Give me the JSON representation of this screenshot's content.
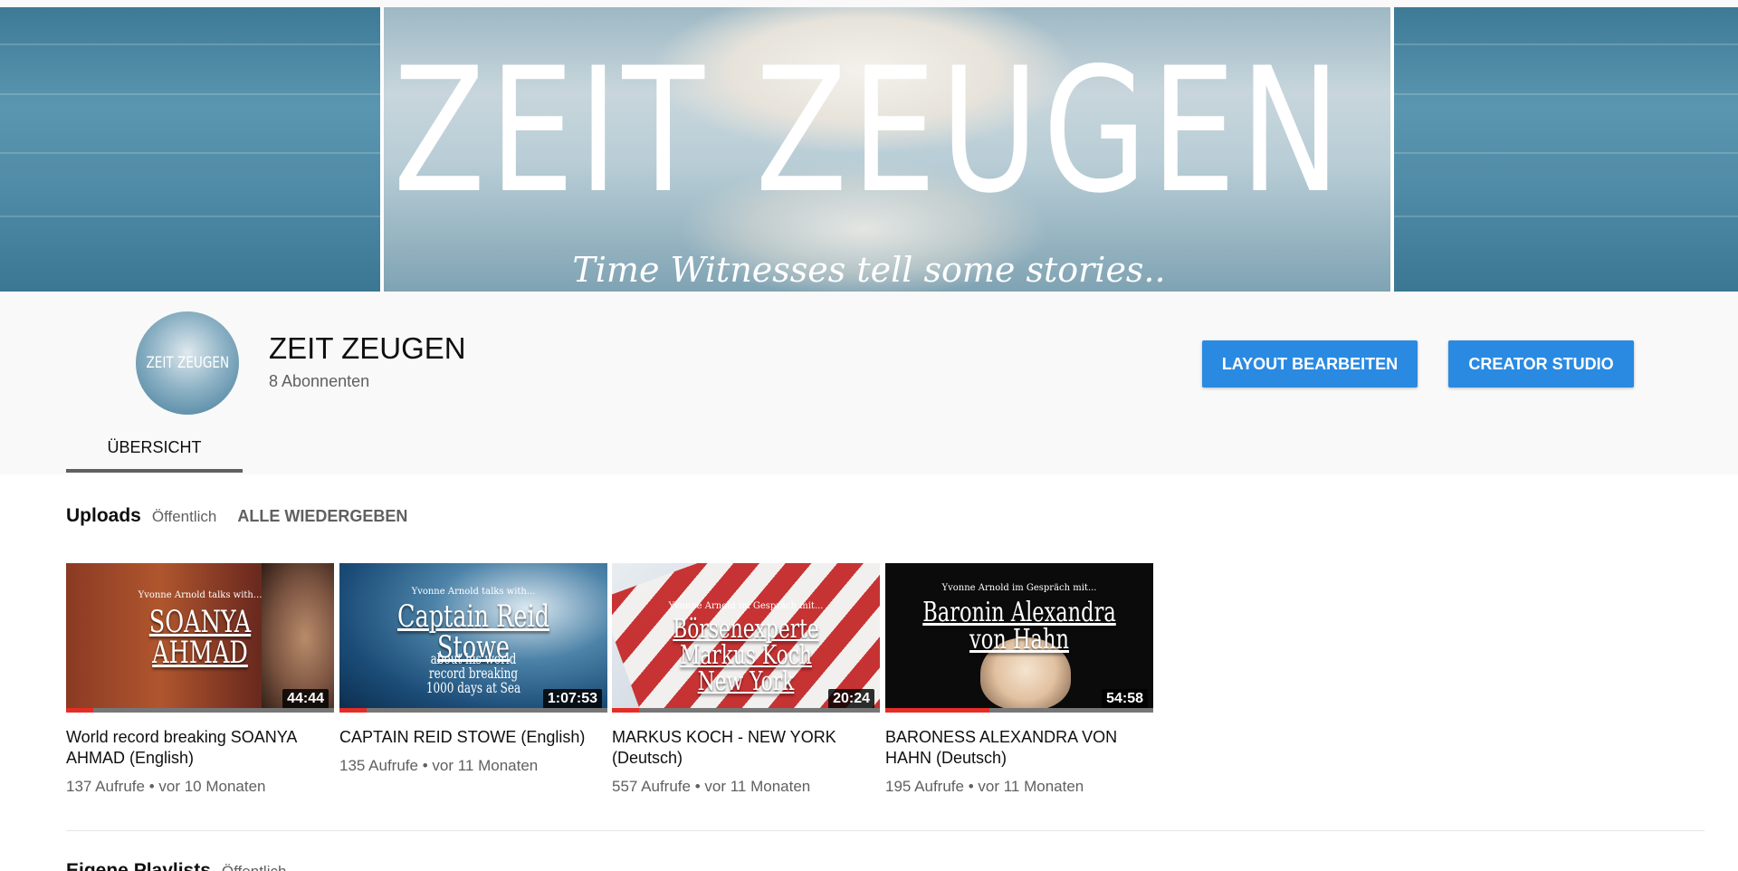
{
  "banner": {
    "title": "ZEIT ZEUGEN",
    "subtitle": "Time Witnesses tell some stories.."
  },
  "channel": {
    "avatar_text": "ZEIT ZEUGEN",
    "name": "ZEIT ZEUGEN",
    "subscribers": "8 Abonnenten",
    "buttons": {
      "layout": "LAYOUT BEARBEITEN",
      "studio": "CREATOR STUDIO"
    },
    "tabs": [
      {
        "label": "ÜBERSICHT",
        "active": true
      }
    ]
  },
  "uploads": {
    "title": "Uploads",
    "visibility": "Öffentlich",
    "play_all": "ALLE WIEDERGEBEN",
    "videos": [
      {
        "thumb_overline": "Yvonne Arnold talks with...",
        "thumb_name": "SOANYA AHMAD",
        "thumb_sub": "",
        "duration": "44:44",
        "progress": 0.1,
        "title": "World record breaking SOANYA AHMAD (English)",
        "views": "137 Aufrufe",
        "age": "vor 10 Monaten"
      },
      {
        "thumb_overline": "Yvonne Arnold talks with...",
        "thumb_name": "Captain Reid Stowe",
        "thumb_sub": "about his world record breaking 1000 days at Sea",
        "duration": "1:07:53",
        "progress": 0.1,
        "title": "CAPTAIN REID STOWE (English)",
        "views": "135 Aufrufe",
        "age": "vor 11 Monaten"
      },
      {
        "thumb_overline": "Yvonne Arnold im Gespräch mit...",
        "thumb_name": "Börsenexperte Markus Koch New York",
        "thumb_sub": "",
        "duration": "20:24",
        "progress": 0.1,
        "title": "MARKUS KOCH - NEW YORK (Deutsch)",
        "views": "557 Aufrufe",
        "age": "vor 11 Monaten"
      },
      {
        "thumb_overline": "Yvonne Arnold im Gespräch mit...",
        "thumb_name": "Baronin Alexandra von Hahn",
        "thumb_sub": "",
        "duration": "54:58",
        "progress": 0.39,
        "title": "BARONESS ALEXANDRA VON HAHN (Deutsch)",
        "views": "195 Aufrufe",
        "age": "vor 11 Monaten"
      }
    ]
  },
  "playlists": {
    "title": "Eigene Playlists",
    "visibility": "Öffentlich"
  },
  "colors": {
    "accent_button": "#2a8ae2",
    "progress_red": "#e52d27"
  }
}
